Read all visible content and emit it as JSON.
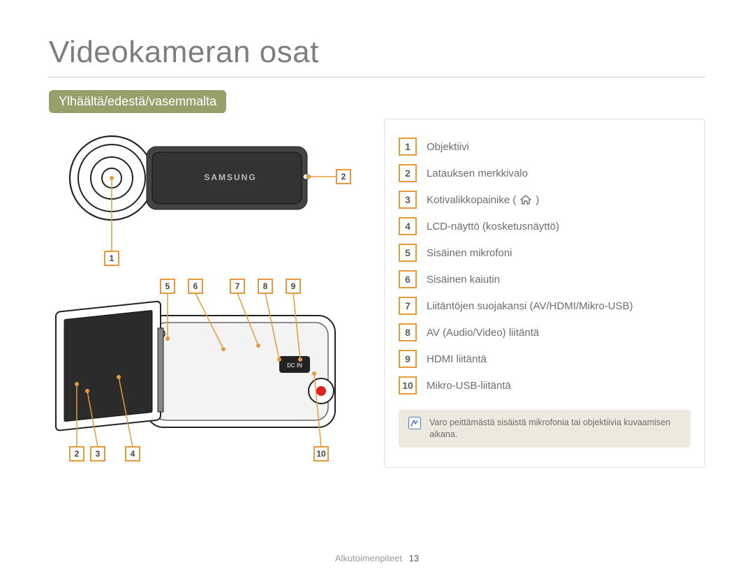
{
  "title": "Videokameran osat",
  "section_label": "Ylhäältä/edestä/vasemmalta",
  "brand_on_device": "SAMSUNG",
  "legend": [
    {
      "n": "1",
      "text": "Objektiivi"
    },
    {
      "n": "2",
      "text": "Latauksen merkkivalo"
    },
    {
      "n": "3",
      "text": "Kotivalikkopainike (",
      "icon": "home",
      "text_after": ")"
    },
    {
      "n": "4",
      "text": "LCD-näyttö (kosketusnäyttö)"
    },
    {
      "n": "5",
      "text": "Sisäinen mikrofoni"
    },
    {
      "n": "6",
      "text": "Sisäinen kaiutin"
    },
    {
      "n": "7",
      "text": "Liitäntöjen suojakansi (AV/HDMI/Mikro-USB)"
    },
    {
      "n": "8",
      "text": "AV (Audio/Video) liitäntä"
    },
    {
      "n": "9",
      "text": "HDMI liitäntä"
    },
    {
      "n": "10",
      "text": "Mikro-USB-liitäntä"
    }
  ],
  "note": "Varo peittämästä sisäistä mikrofonia tai objektiivia kuvaamisen aikana.",
  "footer_label": "Alkutoimenpiteet",
  "page_number": "13",
  "callouts_top": [
    "2"
  ],
  "callouts_mid": [
    "5",
    "6",
    "7",
    "8",
    "9"
  ],
  "callouts_bottom_left": [
    "2",
    "3",
    "4"
  ],
  "callouts_bottom_right": [
    "10"
  ],
  "callouts_top_pointer": [
    "1"
  ],
  "colors": {
    "accent": "#e69a3a",
    "tab": "#97a06a"
  }
}
